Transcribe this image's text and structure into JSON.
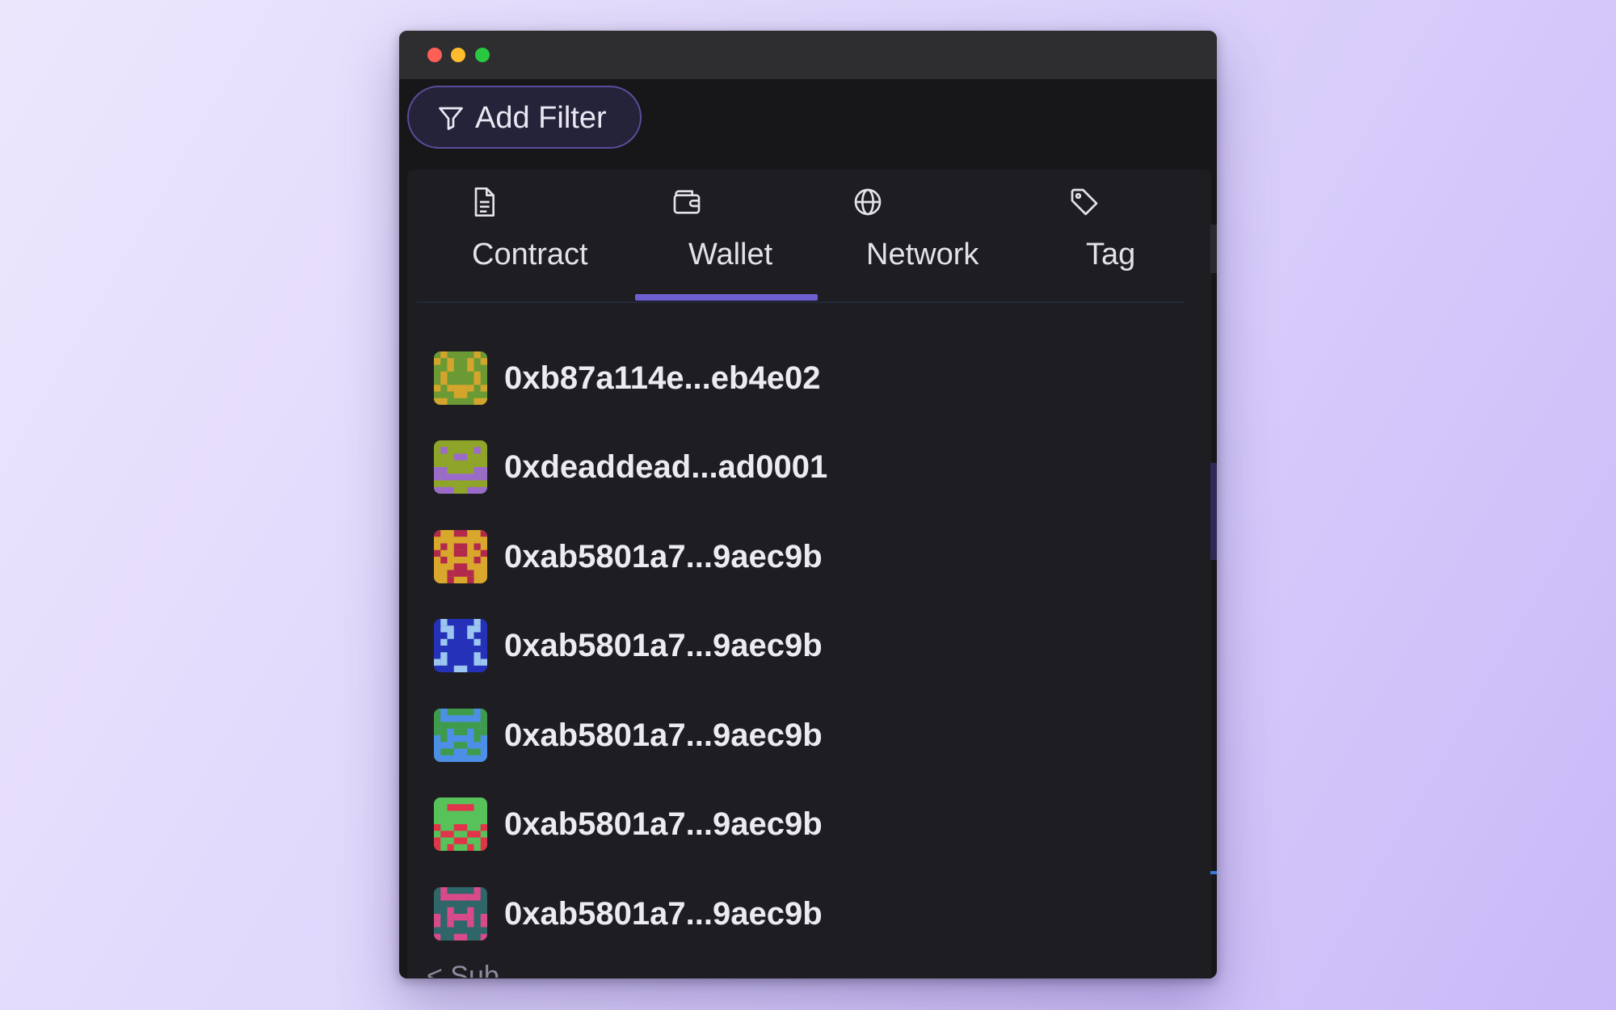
{
  "add_filter": {
    "label": "Add Filter",
    "icon": "filter-icon"
  },
  "tabs": [
    {
      "label": "Contract",
      "icon": "document-icon",
      "active": false
    },
    {
      "label": "Wallet",
      "icon": "wallet-icon",
      "active": true
    },
    {
      "label": "Network",
      "icon": "globe-icon",
      "active": false
    },
    {
      "label": "Tag",
      "icon": "tag-icon",
      "active": false
    }
  ],
  "wallets": [
    {
      "address": "0xb87a114e...eb4e02",
      "colors": [
        "#6b9a34",
        "#d4a52c"
      ]
    },
    {
      "address": "0xdeaddead...ad0001",
      "colors": [
        "#8ea52a",
        "#9a6bcb"
      ]
    },
    {
      "address": "0xab5801a7...9aec9b",
      "colors": [
        "#d8a72b",
        "#b2294b"
      ]
    },
    {
      "address": "0xab5801a7...9aec9b",
      "colors": [
        "#2431b8",
        "#9cc6ef"
      ]
    },
    {
      "address": "0xab5801a7...9aec9b",
      "colors": [
        "#4d8fe6",
        "#3f9b4b"
      ]
    },
    {
      "address": "0xab5801a7...9aec9b",
      "colors": [
        "#58c25a",
        "#e1344a"
      ]
    },
    {
      "address": "0xab5801a7...9aec9b",
      "colors": [
        "#2e6669",
        "#d84a8a"
      ]
    }
  ],
  "truncated_text": "< Sub",
  "accent": "#6c5ecf"
}
